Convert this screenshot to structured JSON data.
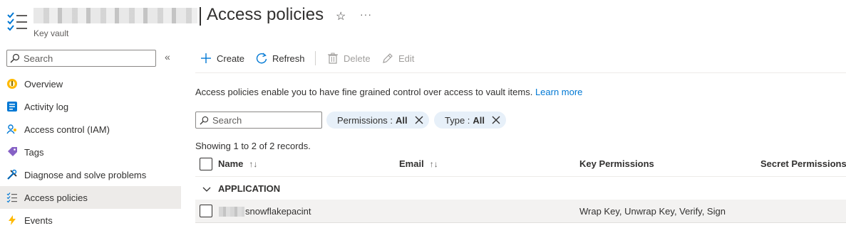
{
  "header": {
    "title": "Access policies",
    "subtitle": "Key vault"
  },
  "sidebar": {
    "search_placeholder": "Search",
    "items": [
      {
        "label": "Overview",
        "icon": "overview-icon"
      },
      {
        "label": "Activity log",
        "icon": "activity-log-icon"
      },
      {
        "label": "Access control (IAM)",
        "icon": "iam-icon"
      },
      {
        "label": "Tags",
        "icon": "tag-icon"
      },
      {
        "label": "Diagnose and solve problems",
        "icon": "diagnose-icon"
      },
      {
        "label": "Access policies",
        "icon": "access-policies-icon",
        "active": true
      },
      {
        "label": "Events",
        "icon": "lightning-icon"
      }
    ]
  },
  "toolbar": {
    "create": "Create",
    "refresh": "Refresh",
    "delete": "Delete",
    "edit": "Edit"
  },
  "info": {
    "text": "Access policies enable you to have fine grained control over access to vault items.",
    "link": "Learn more"
  },
  "filters": {
    "search_placeholder": "Search",
    "pills": [
      {
        "key": "Permissions :",
        "value": "All"
      },
      {
        "key": "Type :",
        "value": "All"
      }
    ]
  },
  "table": {
    "showing": "Showing 1 to 2 of 2 records.",
    "columns": [
      "Name",
      "Email",
      "Key Permissions",
      "Secret Permissions"
    ],
    "sort_glyph": "↑↓",
    "group": "APPLICATION",
    "rows": [
      {
        "name": "snowflakepacint",
        "key_permissions": "Wrap Key, Unwrap Key, Verify, Sign"
      }
    ]
  },
  "colors": {
    "accent": "#0078d4",
    "pill_bg": "#e7f0f9",
    "active_nav_bg": "#edebe9"
  }
}
